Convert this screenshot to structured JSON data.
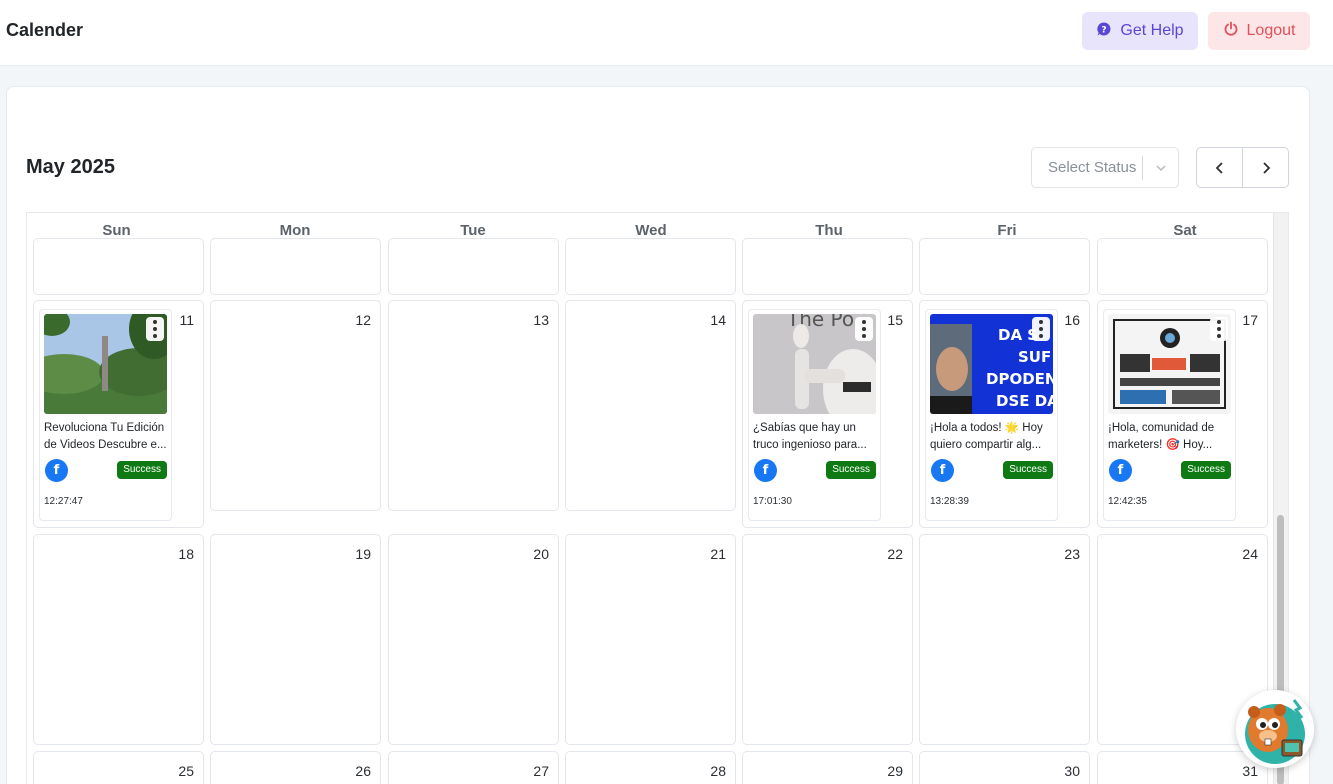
{
  "header": {
    "title": "Calender",
    "help_label": "Get Help",
    "logout_label": "Logout"
  },
  "calendar": {
    "month_label": "May 2025",
    "status_placeholder": "Select Status",
    "weekdays": [
      "Sun",
      "Mon",
      "Tue",
      "Wed",
      "Thu",
      "Fri",
      "Sat"
    ],
    "weeks": [
      [
        "",
        "",
        "",
        "",
        "",
        "",
        ""
      ],
      [
        "11",
        "12",
        "13",
        "14",
        "15",
        "16",
        "17"
      ],
      [
        "18",
        "19",
        "20",
        "21",
        "22",
        "23",
        "24"
      ],
      [
        "25",
        "26",
        "27",
        "28",
        "29",
        "30",
        "31"
      ]
    ],
    "posts": [
      {
        "day": "11",
        "caption": "Revoluciona Tu Edición de Videos Descubre e...",
        "status": "Success",
        "time": "12:27:47",
        "platform": "facebook-icon"
      },
      {
        "day": "15",
        "caption": "¿Sabías que hay un truco ingenioso para...",
        "status": "Success",
        "time": "17:01:30",
        "platform": "facebook-icon",
        "thumb_text": "The Po"
      },
      {
        "day": "16",
        "caption": "¡Hola a todos! 🌟 Hoy quiero compartir alg...",
        "status": "Success",
        "time": "13:28:39",
        "platform": "facebook-icon",
        "thumb_text": "DA S\nSUF\nDPODEN\nDSE DA"
      },
      {
        "day": "17",
        "caption": "¡Hola, comunidad de marketers! 🎯 Hoy...",
        "status": "Success",
        "time": "12:42:35",
        "platform": "facebook-icon"
      }
    ]
  },
  "colors": {
    "success": "#0f7a14",
    "facebook": "#1877f2",
    "help_bg": "#e8e4fb",
    "logout_bg": "#fde6e7"
  }
}
